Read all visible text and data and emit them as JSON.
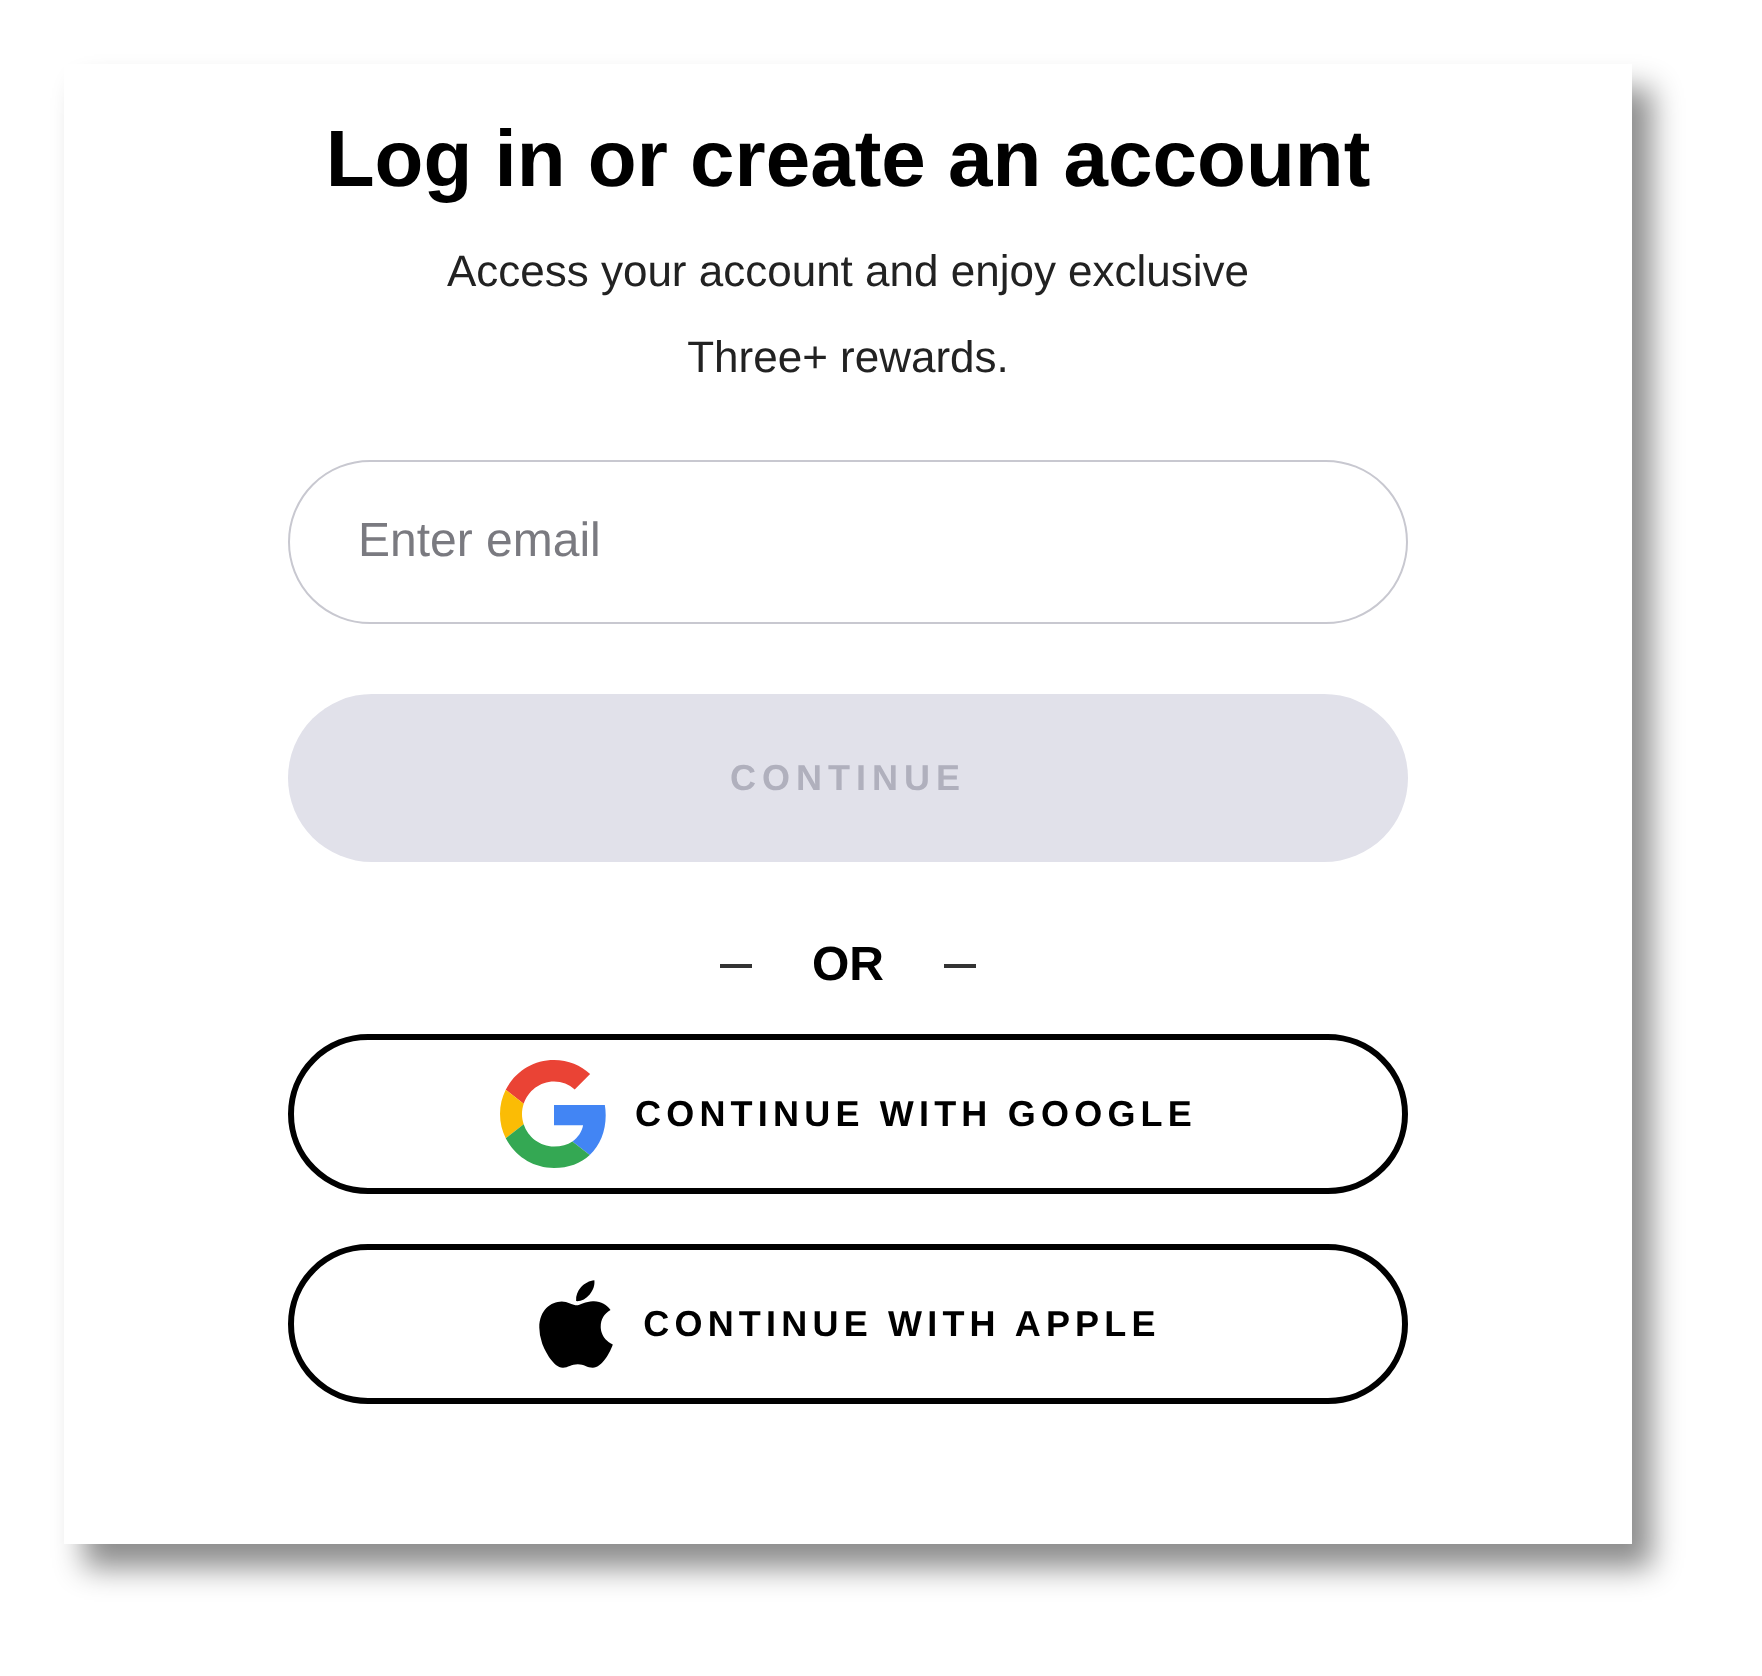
{
  "title": "Log in or create an account",
  "subtitle": "Access your account and enjoy exclusive Three+ rewards.",
  "email_field": {
    "placeholder": "Enter email"
  },
  "continue_button": {
    "label": "CONTINUE",
    "disabled": true
  },
  "separator": "OR",
  "providers": [
    {
      "kind": "google",
      "label": "CONTINUE WITH GOOGLE"
    },
    {
      "kind": "apple",
      "label": "CONTINUE WITH APPLE"
    }
  ]
}
